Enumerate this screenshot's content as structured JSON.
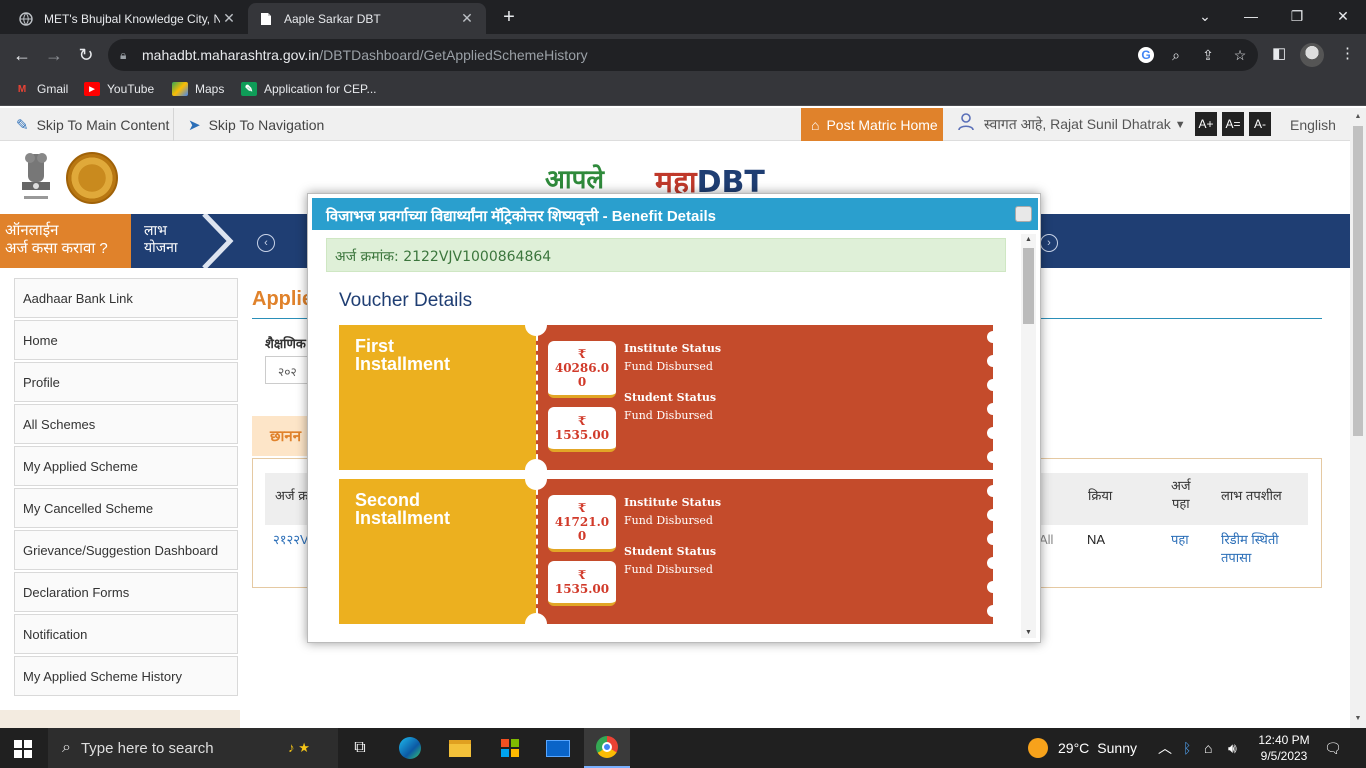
{
  "browser": {
    "tabs": [
      {
        "title": "MET's Bhujbal Knowledge City, N"
      },
      {
        "title": "Aaple Sarkar DBT"
      }
    ],
    "url_host": "mahadbt.maharashtra.gov.in",
    "url_path": "/DBTDashboard/GetAppliedSchemeHistory",
    "bookmarks": [
      {
        "label": "Gmail"
      },
      {
        "label": "YouTube"
      },
      {
        "label": "Maps"
      },
      {
        "label": "Application for CEP..."
      }
    ]
  },
  "utilbar": {
    "skip_main": "Skip To Main Content",
    "skip_nav": "Skip To Navigation",
    "post_matric_home": "Post Matric Home",
    "welcome": "स्वागत आहे, Rajat Sunil Dhatrak",
    "font_increase": "A+",
    "font_normal": "A=",
    "font_decrease": "A-",
    "language": "English"
  },
  "header": {
    "logo_aaple": "आपले",
    "logo_maha": "महा",
    "logo_dbt": "DBT"
  },
  "bluebar": {
    "howto_line1": "ऑनलाईन",
    "howto_line2": "अर्ज कसा करावा ?",
    "labh_line1": "लाभ",
    "labh_line2": "योजना"
  },
  "sidebar": {
    "items": [
      {
        "label": "Aadhaar Bank Link"
      },
      {
        "label": "Home"
      },
      {
        "label": "Profile"
      },
      {
        "label": "All Schemes"
      },
      {
        "label": "My Applied Scheme"
      },
      {
        "label": "My Cancelled Scheme"
      },
      {
        "label": "Grievance/Suggestion Dashboard"
      },
      {
        "label": "Declaration Forms"
      },
      {
        "label": "Notification"
      },
      {
        "label": "My Applied Scheme History"
      }
    ]
  },
  "content": {
    "title": "Applie",
    "academic_label": "शैक्षणिक",
    "year_value": "२०२",
    "filter_label": "छानन",
    "table_headers": {
      "app_no": "अर्ज क्र",
      "action": "क्रिया",
      "view_app_1": "अर्ज",
      "view_app_2": "पहा",
      "benefit": "लाभ तपशील"
    },
    "row": {
      "app_no": "२१२२V",
      "col_all": "All",
      "action": "NA",
      "view": "पहा",
      "benefit_1": "रिडीम स्थिती",
      "benefit_2": "तपासा"
    }
  },
  "modal": {
    "title": "विजाभज प्रवर्गाच्या विद्यार्थ्यांना मॅट्रिकोत्तर शिष्यवृत्ती - Benefit Details",
    "application_no": "अर्ज क्रमांक: 2122VJV1000864864",
    "voucher_title": "Voucher Details",
    "installments": [
      {
        "name_1": "First",
        "name_2": "Installment",
        "institute_amount": "₹ 40286.0 0",
        "institute_status_label": "Institute Status",
        "institute_status": "Fund Disbursed",
        "student_amount": "₹ 1535.00",
        "student_status_label": "Student Status",
        "student_status": "Fund Disbursed"
      },
      {
        "name_1": "Second",
        "name_2": "Installment",
        "institute_amount": "₹ 41721.0 0",
        "institute_status_label": "Institute Status",
        "institute_status": "Fund Disbursed",
        "student_amount": "₹ 1535.00",
        "student_status_label": "Student Status",
        "student_status": "Fund Disbursed"
      }
    ]
  },
  "taskbar": {
    "search_placeholder": "Type here to search",
    "weather_temp": "29°C",
    "weather_text": "Sunny",
    "time": "12:40 PM",
    "date": "9/5/2023"
  },
  "colors": {
    "accent_orange": "#e0822b",
    "navy": "#1f3e73",
    "modal_header": "#2a9fce",
    "voucher_yellow": "#ecb01f",
    "voucher_red": "#c44b2b"
  }
}
